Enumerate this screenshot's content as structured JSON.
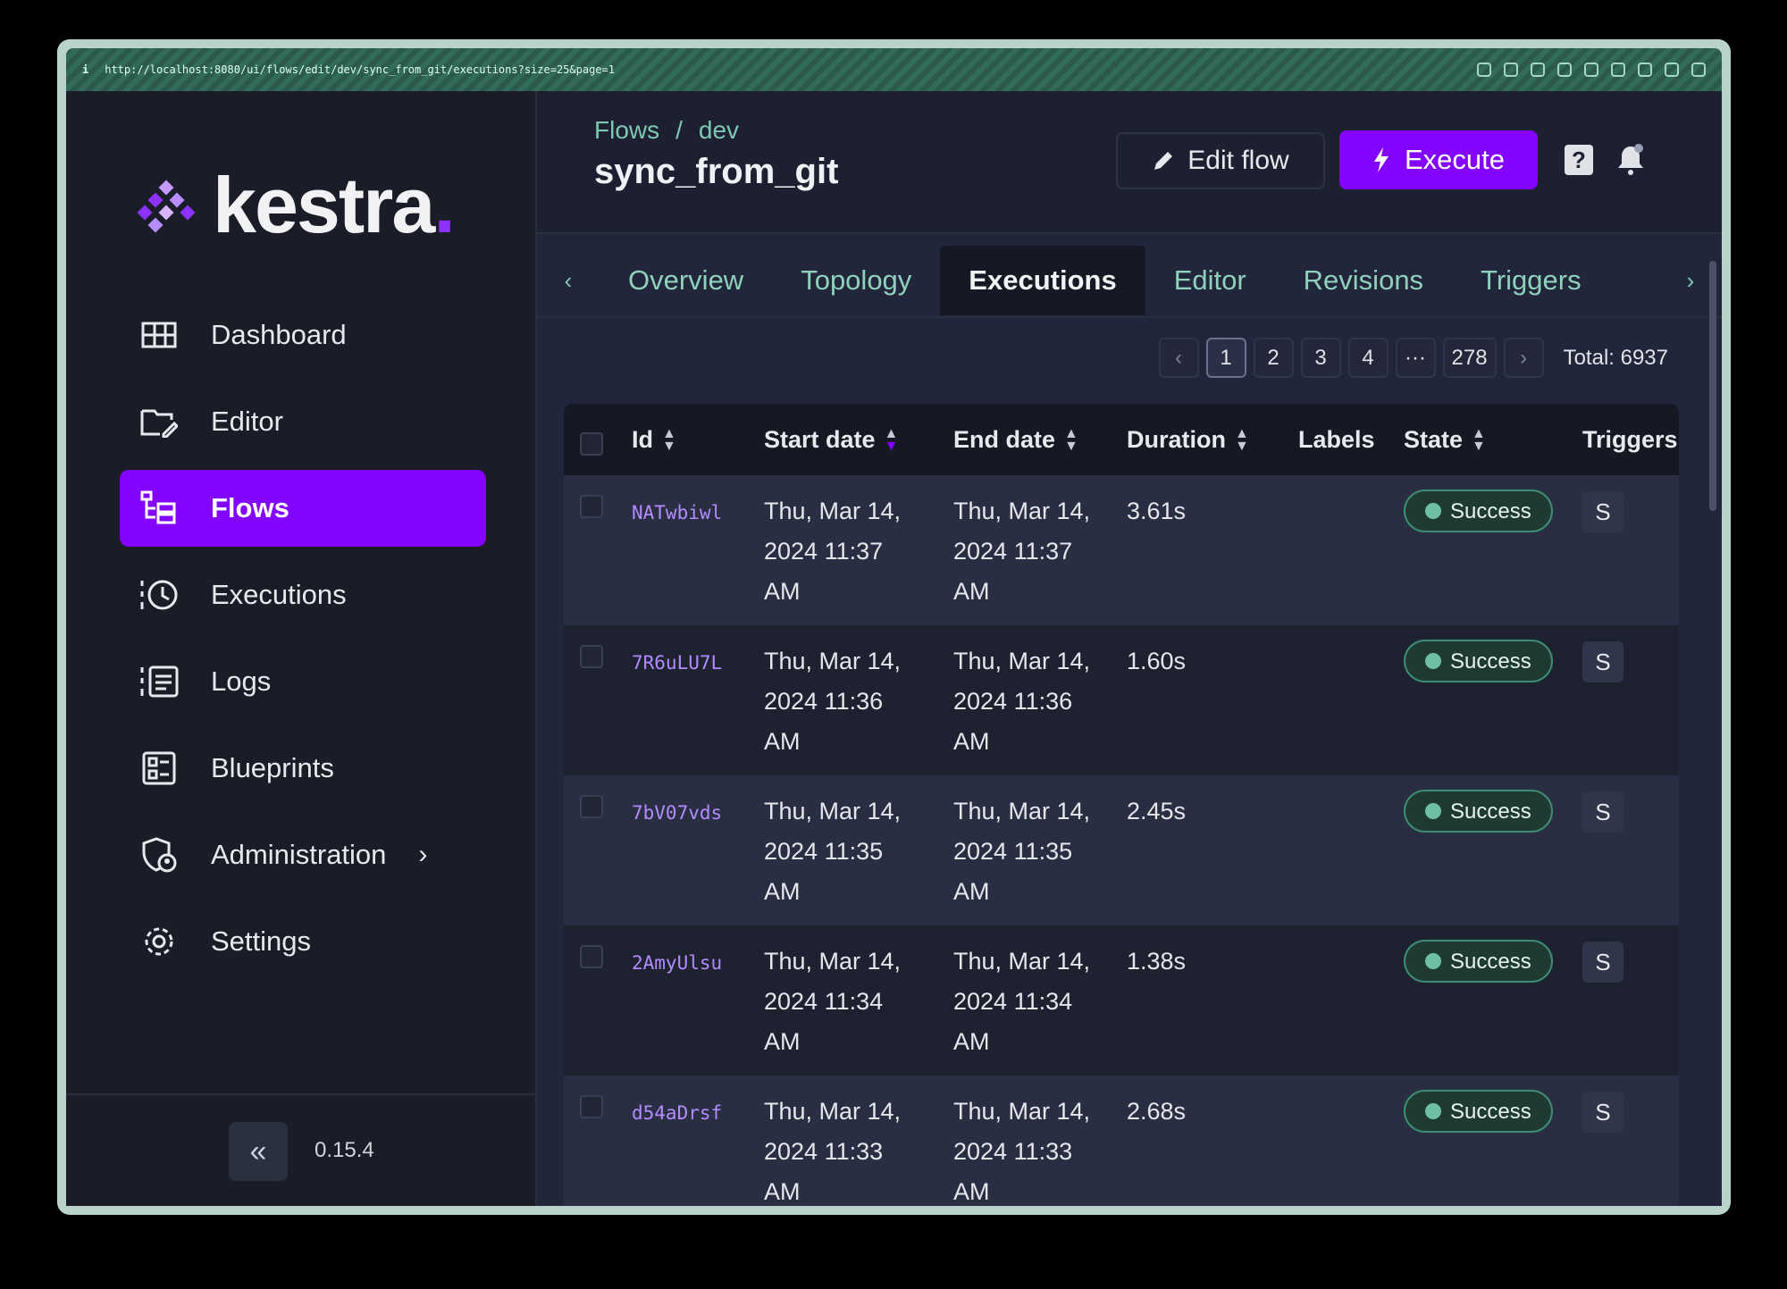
{
  "browser": {
    "url": "http://localhost:8080/ui/flows/edit/dev/sync_from_git/executions?size=25&page=1",
    "info": "i"
  },
  "brand": {
    "name": "kestra",
    "dot": "."
  },
  "sidebar": {
    "items": [
      {
        "label": "Dashboard",
        "icon": "dashboard-icon"
      },
      {
        "label": "Editor",
        "icon": "editor-icon"
      },
      {
        "label": "Flows",
        "icon": "flows-icon",
        "active": true
      },
      {
        "label": "Executions",
        "icon": "executions-icon"
      },
      {
        "label": "Logs",
        "icon": "logs-icon"
      },
      {
        "label": "Blueprints",
        "icon": "blueprints-icon"
      },
      {
        "label": "Administration",
        "icon": "administration-icon",
        "has_chevron": true
      },
      {
        "label": "Settings",
        "icon": "settings-icon"
      }
    ],
    "collapse_glyph": "«",
    "version": "0.15.4"
  },
  "header": {
    "breadcrumb": [
      "Flows",
      "/",
      "dev"
    ],
    "title": "sync_from_git",
    "edit_label": "Edit flow",
    "execute_label": "Execute",
    "help_glyph": "?"
  },
  "tabs": {
    "items": [
      "Overview",
      "Topology",
      "Executions",
      "Editor",
      "Revisions",
      "Triggers"
    ],
    "active": "Executions",
    "prev_glyph": "‹",
    "next_glyph": "›"
  },
  "pagination": {
    "prev": "‹",
    "pages": [
      "1",
      "2",
      "3",
      "4",
      "···",
      "278"
    ],
    "current": "1",
    "next": "›",
    "total_label": "Total: 6937"
  },
  "table": {
    "columns": [
      "Id",
      "Start date",
      "End date",
      "Duration",
      "Labels",
      "State",
      "Triggers"
    ],
    "rows": [
      {
        "id": "NATwbiwl",
        "start": [
          "Thu, Mar 14,",
          "2024 11:37",
          "AM"
        ],
        "end": [
          "Thu, Mar 14,",
          "2024 11:37",
          "AM"
        ],
        "duration": "3.61s",
        "labels": "",
        "state": "Success",
        "trigger": "S"
      },
      {
        "id": "7R6uLU7L",
        "start": [
          "Thu, Mar 14,",
          "2024 11:36",
          "AM"
        ],
        "end": [
          "Thu, Mar 14,",
          "2024 11:36",
          "AM"
        ],
        "duration": "1.60s",
        "labels": "",
        "state": "Success",
        "trigger": "S"
      },
      {
        "id": "7bV07vds",
        "start": [
          "Thu, Mar 14,",
          "2024 11:35",
          "AM"
        ],
        "end": [
          "Thu, Mar 14,",
          "2024 11:35",
          "AM"
        ],
        "duration": "2.45s",
        "labels": "",
        "state": "Success",
        "trigger": "S"
      },
      {
        "id": "2AmyUlsu",
        "start": [
          "Thu, Mar 14,",
          "2024 11:34",
          "AM"
        ],
        "end": [
          "Thu, Mar 14,",
          "2024 11:34",
          "AM"
        ],
        "duration": "1.38s",
        "labels": "",
        "state": "Success",
        "trigger": "S"
      },
      {
        "id": "d54aDrsf",
        "start": [
          "Thu, Mar 14,",
          "2024 11:33",
          "AM"
        ],
        "end": [
          "Thu, Mar 14,",
          "2024 11:33",
          "AM"
        ],
        "duration": "2.68s",
        "labels": "",
        "state": "Success",
        "trigger": "S"
      }
    ]
  },
  "colors": {
    "accent": "#8405ff",
    "link": "#7ec8b3",
    "success": "#3d8d74"
  }
}
